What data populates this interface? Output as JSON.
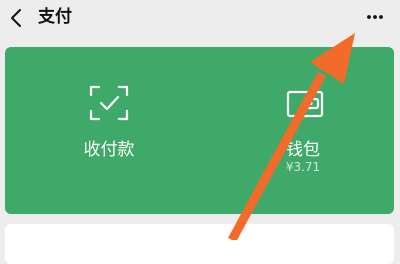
{
  "header": {
    "back_icon": "chevron-left-icon",
    "title": "支付",
    "more_icon": "more-dots-icon"
  },
  "main": {
    "tiles": [
      {
        "label": "收付款",
        "icon": "scan-check-icon"
      },
      {
        "label": "钱包",
        "icon": "wallet-icon",
        "amount": "¥3.71"
      }
    ]
  },
  "overlay": {
    "annotation": "orange-pointer-arrow",
    "color": "#f26b2a"
  },
  "colors": {
    "panel": "#3fa96a",
    "background": "#ededed"
  }
}
